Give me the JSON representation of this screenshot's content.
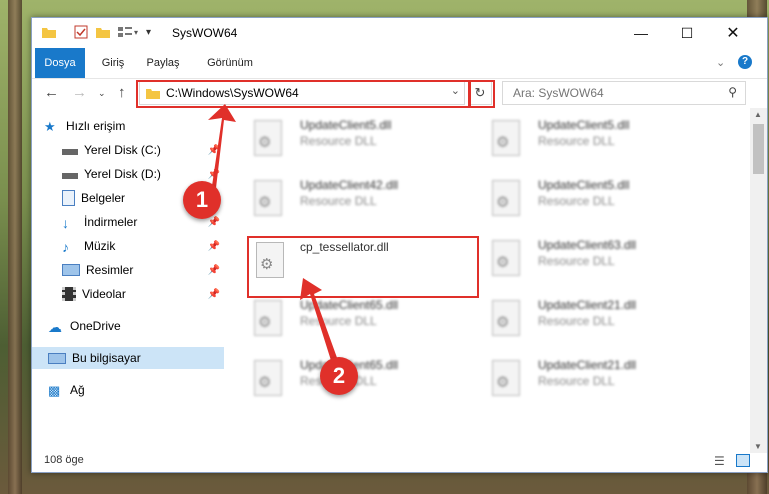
{
  "window": {
    "title": "SysWOW64"
  },
  "ribbon": {
    "tabs": [
      "Dosya",
      "Giriş",
      "Paylaş",
      "Görünüm"
    ]
  },
  "address": {
    "path": "C:\\Windows\\SysWOW64"
  },
  "search": {
    "placeholder": "Ara: SysWOW64"
  },
  "sidebar": {
    "items": [
      {
        "label": "Hızlı erişim",
        "icon": "star-icon"
      },
      {
        "label": "Yerel Disk (C:)",
        "icon": "drive-icon"
      },
      {
        "label": "Yerel Disk (D:)",
        "icon": "drive-icon"
      },
      {
        "label": "Belgeler",
        "icon": "documents-icon"
      },
      {
        "label": "İndirmeler",
        "icon": "download-icon"
      },
      {
        "label": "Müzik",
        "icon": "music-icon"
      },
      {
        "label": "Resimler",
        "icon": "pictures-icon"
      },
      {
        "label": "Videolar",
        "icon": "video-icon"
      },
      {
        "label": "OneDrive",
        "icon": "cloud-icon"
      },
      {
        "label": "Bu bilgisayar",
        "icon": "computer-icon"
      },
      {
        "label": "Ağ",
        "icon": "network-icon"
      }
    ]
  },
  "files": [
    {
      "name": "UpdateClient5.dll",
      "desc": "Resource DLL"
    },
    {
      "name": "UpdateClient5.dll",
      "desc": "Resource DLL"
    },
    {
      "name": "UpdateClient42.dll",
      "desc": "Resource DLL"
    },
    {
      "name": "UpdateClient5.dll",
      "desc": "Resource DLL"
    },
    {
      "name": "cp_tessellator.dll",
      "desc": ""
    },
    {
      "name": "UpdateClient63.dll",
      "desc": "Resource DLL"
    },
    {
      "name": "UpdateClient65.dll",
      "desc": "Resource DLL"
    },
    {
      "name": "UpdateClient21.dll",
      "desc": "Resource DLL"
    },
    {
      "name": "UpdateClient65.dll",
      "desc": "Resource DLL"
    },
    {
      "name": "UpdateClient21.dll",
      "desc": "Resource DLL"
    }
  ],
  "status": {
    "count": "108 öge"
  },
  "annotations": {
    "step1": "1",
    "step2": "2"
  },
  "colors": {
    "accent": "#1979ca",
    "highlight": "#e0302a",
    "selected": "#cce4f7"
  }
}
